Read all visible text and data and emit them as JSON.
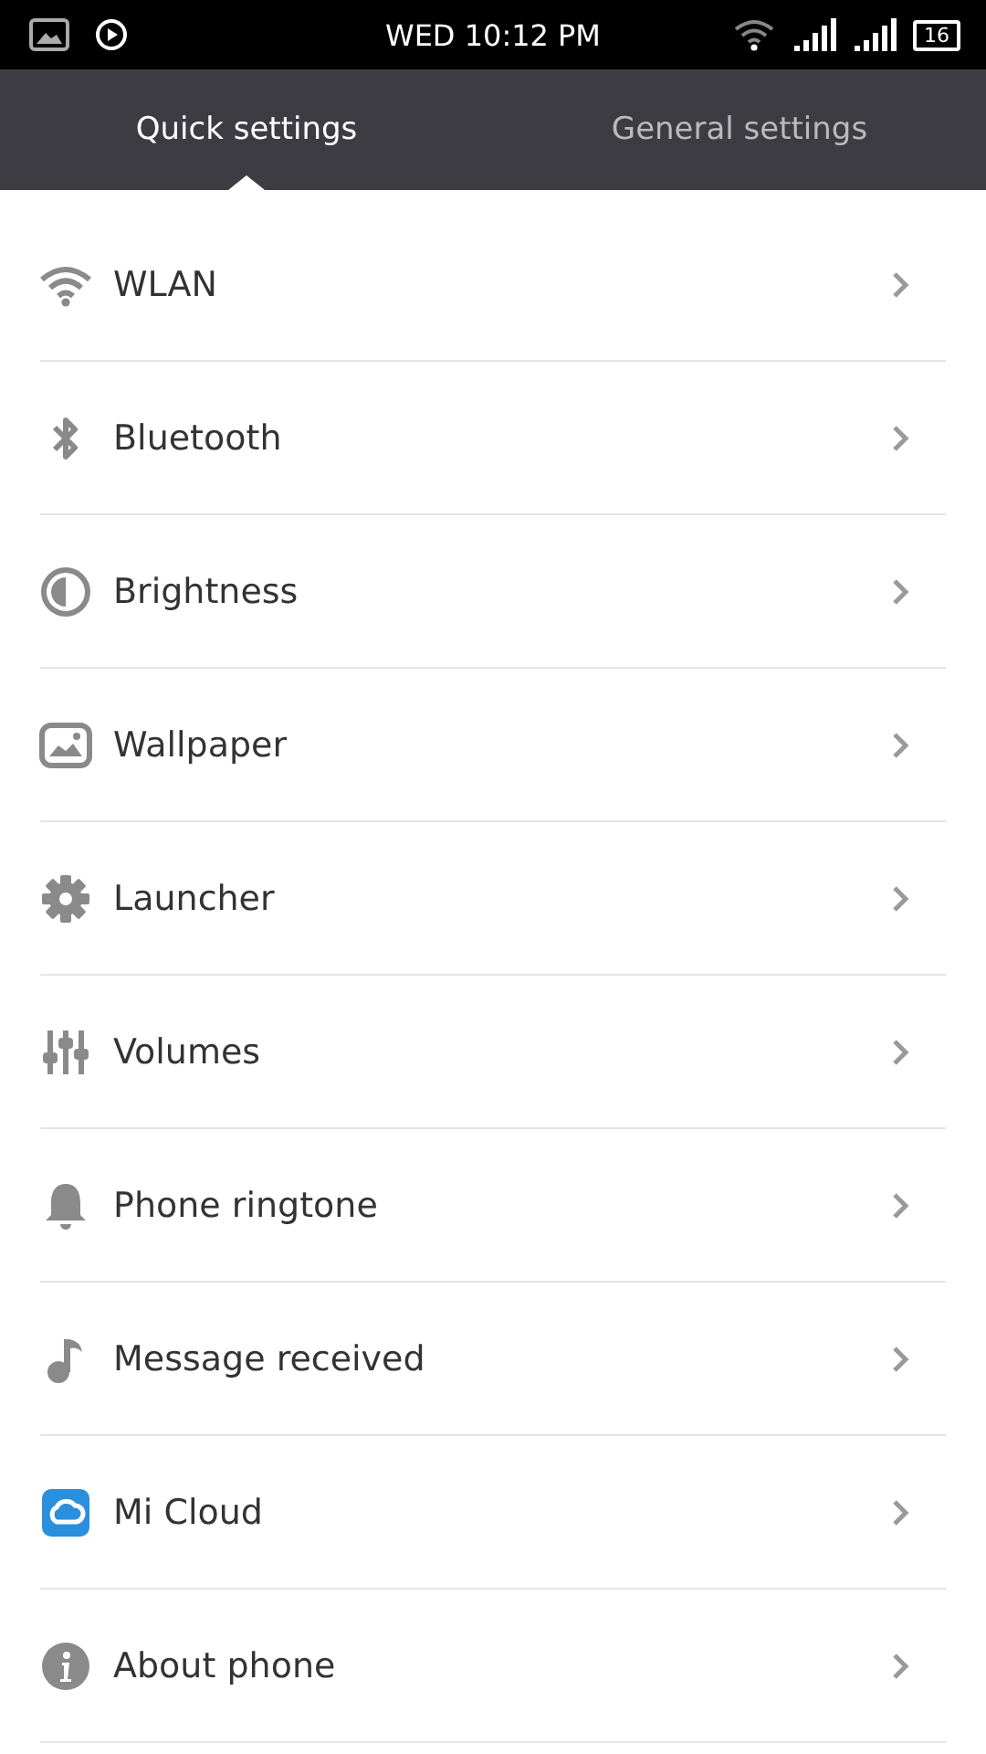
{
  "status_bar": {
    "time": "WED 10:12 PM",
    "battery": "16"
  },
  "tabs": [
    {
      "label": "Quick settings",
      "selected": true
    },
    {
      "label": "General settings",
      "selected": false
    }
  ],
  "items": [
    {
      "label": "WLAN",
      "kind": "wifi"
    },
    {
      "label": "Bluetooth",
      "kind": "bluetooth"
    },
    {
      "label": "Brightness",
      "kind": "brightness"
    },
    {
      "label": "Wallpaper",
      "kind": "wallpaper"
    },
    {
      "label": "Launcher",
      "kind": "gear"
    },
    {
      "label": "Volumes",
      "kind": "sliders"
    },
    {
      "label": "Phone ringtone",
      "kind": "bell"
    },
    {
      "label": "Message received",
      "kind": "note"
    },
    {
      "label": "Mi Cloud",
      "kind": "cloud"
    },
    {
      "label": "About phone",
      "kind": "info"
    }
  ]
}
